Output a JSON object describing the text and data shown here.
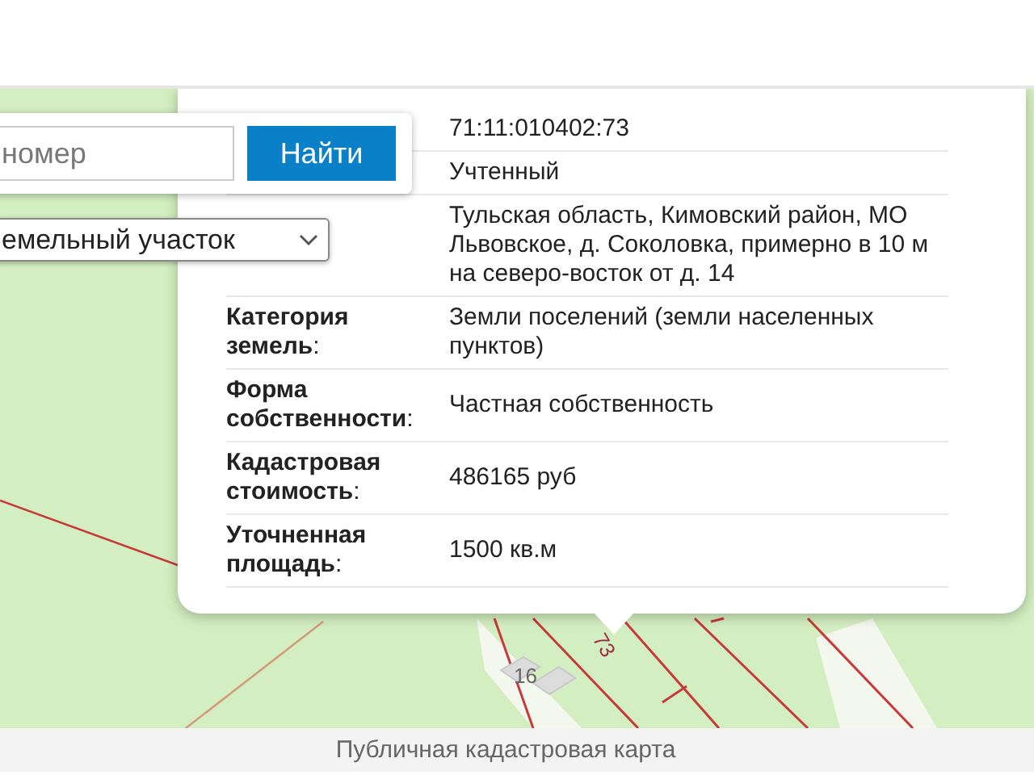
{
  "search": {
    "placeholder": "номер",
    "button": "Найти",
    "select_value": "емельный участок"
  },
  "popup": {
    "rows": [
      {
        "value": "71:11:010402:73"
      },
      {
        "value": "Учтенный"
      },
      {
        "value": "Тульская область, Кимовский район, МО Львовское, д. Соколовка, примерно в 10 м на северо-восток от д. 14"
      },
      {
        "label": "**Категория земель**:",
        "value": "Земли поселений (земли населенных пунктов)"
      },
      {
        "label": "**Форма собственности**:",
        "value": "Частная собственность"
      },
      {
        "label": "**Кадастровая стоимость**:",
        "value": "486165 руб"
      },
      {
        "label": "**Уточненная площадь**:",
        "value": "1500 кв.м"
      }
    ]
  },
  "map": {
    "labels": [
      "16",
      "73"
    ]
  },
  "caption": "Публичная кадастровая карта"
}
